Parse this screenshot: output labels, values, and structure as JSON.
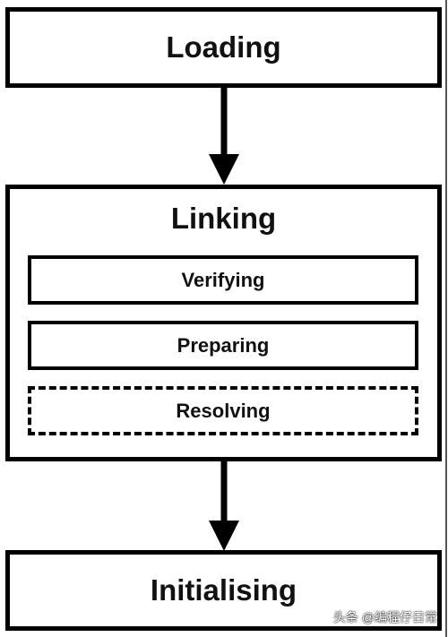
{
  "stages": {
    "loading": "Loading",
    "linking": "Linking",
    "linking_steps": [
      "Verifying",
      "Preparing",
      "Resolving"
    ],
    "initialising": "Initialising"
  },
  "watermark": "头条 @编程仔日常"
}
